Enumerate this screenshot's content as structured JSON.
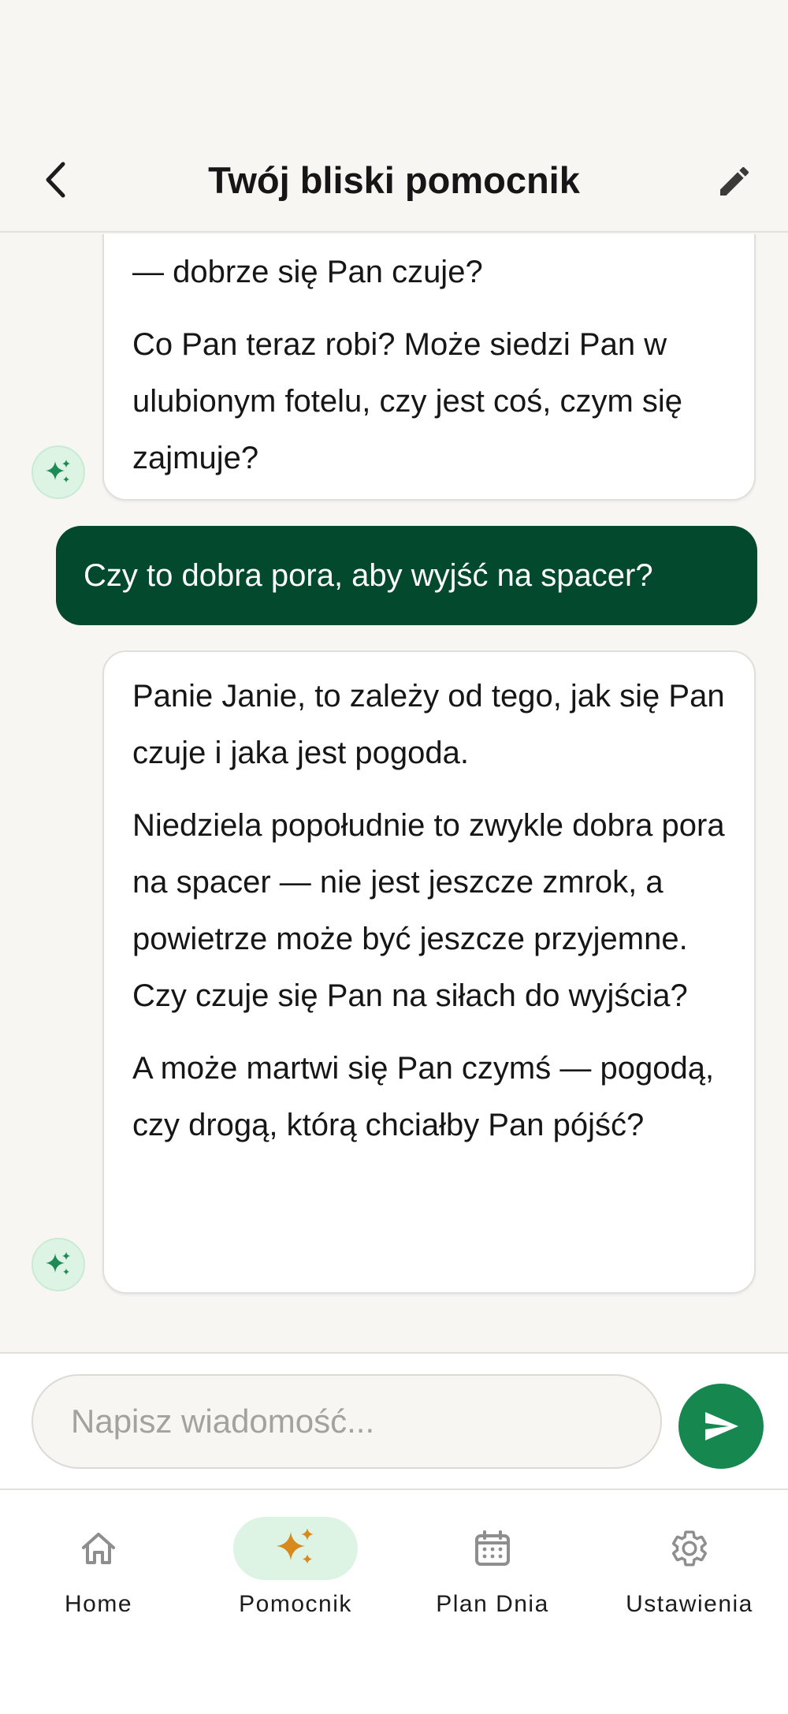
{
  "header": {
    "title": "Twój bliski pomocnik",
    "back_icon": "chevron-left-icon",
    "edit_icon": "pencil-icon"
  },
  "messages": [
    {
      "role": "assistant",
      "paragraphs": [
        "— dobrze się Pan czuje?",
        "Co Pan teraz robi? Może siedzi Pan w ulubionym fotelu, czy jest coś, czym się zajmuje?"
      ]
    },
    {
      "role": "user",
      "text": "Czy to dobra pora, aby wyjść na spacer?"
    },
    {
      "role": "assistant",
      "paragraphs": [
        "Panie Janie, to zależy od tego, jak się Pan czuje i jaka jest pogoda.",
        "Niedziela popołudnie to zwykle dobra pora na spacer — nie jest jeszcze zmrok, a powietrze może być jeszcze przyjemne. Czy czuje się Pan na siłach do wyjścia?",
        "A może martwi się Pan czymś — pogodą, czy drogą, którą chciałby Pan pójść?"
      ]
    }
  ],
  "composer": {
    "placeholder": "Napisz wiadomość...",
    "value": "",
    "send_icon": "send-icon"
  },
  "nav": {
    "active": "Pomocnik",
    "items": [
      {
        "label": "Home",
        "icon": "home-icon"
      },
      {
        "label": "Pomocnik",
        "icon": "sparkles-icon"
      },
      {
        "label": "Plan Dnia",
        "icon": "calendar-icon"
      },
      {
        "label": "Ustawienia",
        "icon": "gear-icon"
      }
    ]
  },
  "colors": {
    "user_bubble": "#02492e",
    "accent_green": "#15874f",
    "avatar_bg": "#ddf4e4",
    "sparkle_gold": "#d7891c",
    "background": "#f7f6f3"
  }
}
